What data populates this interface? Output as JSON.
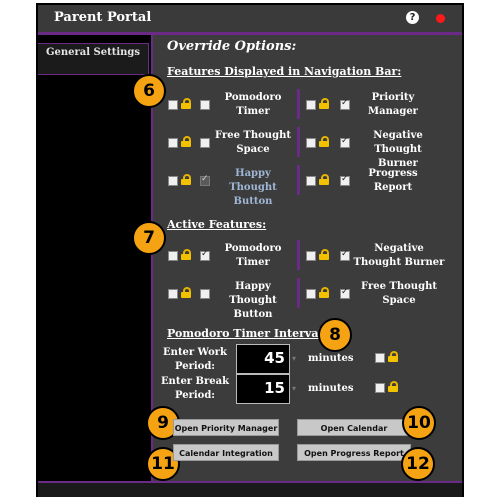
{
  "window": {
    "title": "Parent Portal",
    "help_icon": "help-icon",
    "record_icon": "record-dot-icon",
    "record_color": "#ff1a1a"
  },
  "sidebar": {
    "items": [
      {
        "label": "General Settings"
      }
    ]
  },
  "main": {
    "heading": "Override Options:",
    "nav_section": {
      "title": "Features Displayed in Navigation Bar:",
      "badge": "6",
      "features": [
        {
          "label": "Pomodoro Timer",
          "checked": false,
          "locked": true
        },
        {
          "label": "Priority Manager",
          "checked": true,
          "locked": true
        },
        {
          "label": "Free Thought Space",
          "checked": false,
          "locked": true
        },
        {
          "label": "Negative Thought Burner",
          "checked": true,
          "locked": true
        },
        {
          "label": "Happy Thought Button",
          "checked": true,
          "locked": true,
          "disabled": true
        },
        {
          "label": "Progress Report",
          "checked": true,
          "locked": true
        }
      ]
    },
    "active_section": {
      "title": "Active Features:",
      "badge": "7",
      "features": [
        {
          "label": "Pomodoro Timer",
          "checked": true,
          "locked": true
        },
        {
          "label": "Negative Thought Burner",
          "checked": true,
          "locked": true
        },
        {
          "label": "Happy Thought Button",
          "checked": false,
          "locked": true
        },
        {
          "label": "Free Thought Space",
          "checked": true,
          "locked": true
        }
      ]
    },
    "pomodoro_section": {
      "title": "Pomodoro Timer Intervals:",
      "badge": "8",
      "work_label": "Enter Work Period:",
      "work_value": "45",
      "break_label": "Enter Break Period:",
      "break_value": "15",
      "unit": "minutes"
    },
    "buttons": {
      "priority_manager": "Open Priority Manager",
      "calendar": "Open Calendar",
      "calendar_integration": "Calendar Integration",
      "progress_report": "Open Progress Report"
    },
    "badges": {
      "b9": "9",
      "b10": "10",
      "b11": "11",
      "b12": "12"
    }
  },
  "colors": {
    "accent_purple": "#6a2a86",
    "badge_orange": "#f5a312",
    "lock_yellow": "#f2c200",
    "panel_grey": "#3c3c3c"
  }
}
